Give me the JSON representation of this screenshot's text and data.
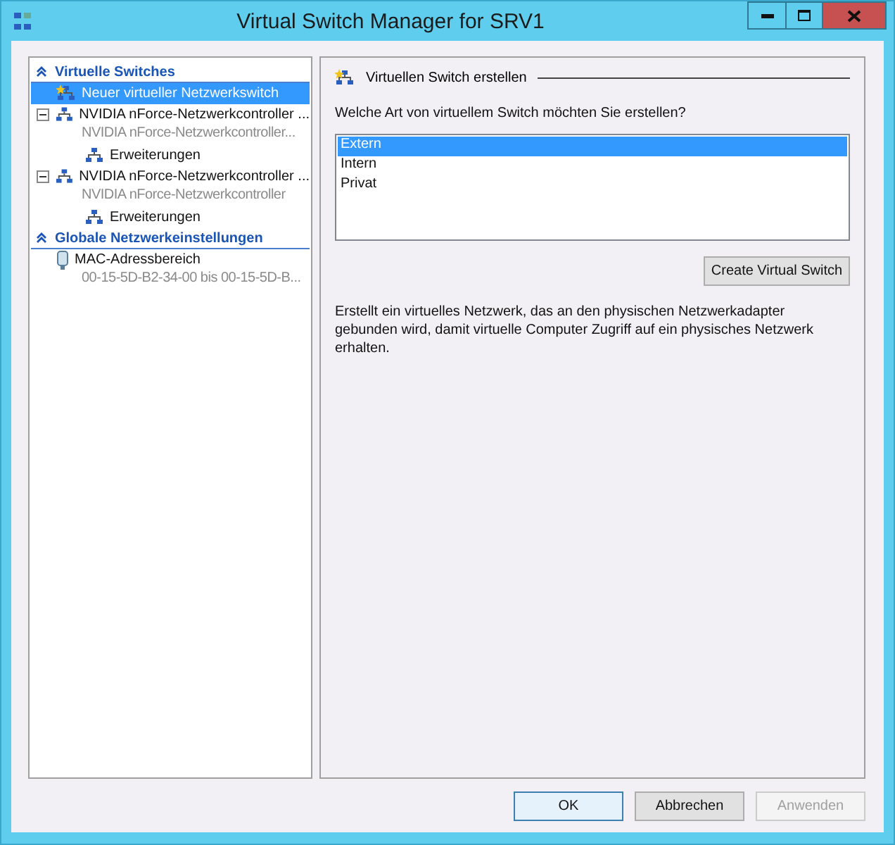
{
  "window": {
    "title": "Virtual Switch Manager for SRV1"
  },
  "sidebar": {
    "sections": [
      {
        "title": "Virtuelle Switches",
        "expanded": true,
        "items": [
          {
            "kind": "new_switch",
            "label": "Neuer virtueller Netzwerkswitch",
            "selected": true
          },
          {
            "kind": "switch",
            "label": "NVIDIA nForce-Netzwerkcontroller ...",
            "sublabel": "NVIDIA nForce-Netzwerkcontroller...",
            "selected": false,
            "expanded": true,
            "children": [
              {
                "kind": "extension",
                "label": "Erweiterungen",
                "selected": false
              }
            ]
          },
          {
            "kind": "switch",
            "label": "NVIDIA nForce-Netzwerkcontroller ...",
            "sublabel": "NVIDIA nForce-Netzwerkcontroller",
            "selected": false,
            "expanded": true,
            "children": [
              {
                "kind": "extension",
                "label": "Erweiterungen",
                "selected": false
              }
            ]
          }
        ]
      },
      {
        "title": "Globale Netzwerkeinstellungen",
        "expanded": true,
        "items": [
          {
            "kind": "mac",
            "label": "MAC-Adressbereich",
            "sublabel": "00-15-5D-B2-34-00 bis 00-15-5D-B...",
            "selected": false
          }
        ]
      }
    ]
  },
  "panel": {
    "heading": "Virtuellen Switch erstellen",
    "question": "Welche Art von virtuellem Switch möchten Sie erstellen?",
    "options": [
      {
        "label": "Extern",
        "selected": true
      },
      {
        "label": "Intern",
        "selected": false
      },
      {
        "label": "Privat",
        "selected": false
      }
    ],
    "create_button": "Create Virtual Switch",
    "description": "Erstellt ein virtuelles Netzwerk, das an den physischen Netzwerkadapter gebunden wird, damit virtuelle Computer Zugriff auf ein physisches Netzwerk erhalten."
  },
  "buttons": [
    {
      "label": "OK",
      "kind": "default",
      "disabled": false
    },
    {
      "label": "Abbrechen",
      "kind": "normal",
      "disabled": false
    },
    {
      "label": "Anwenden",
      "kind": "normal",
      "disabled": true
    }
  ]
}
